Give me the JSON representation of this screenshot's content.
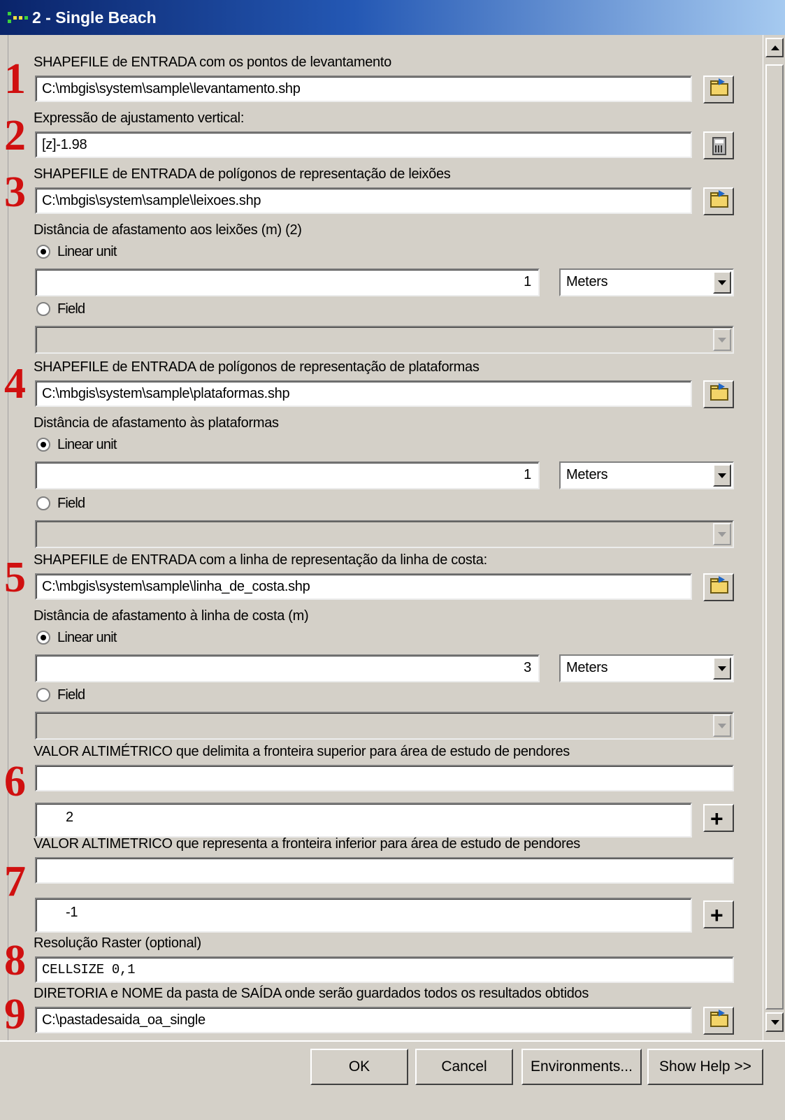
{
  "window": {
    "title": "2 - Single Beach",
    "icon": "toolbox-model-icon"
  },
  "numbers": [
    "1",
    "2",
    "3",
    "4",
    "5",
    "6",
    "7",
    "8",
    "9"
  ],
  "params": {
    "p1": {
      "label": "SHAPEFILE de ENTRADA com os pontos de levantamento",
      "value": "C:\\mbgis\\system\\sample\\levantamento.shp"
    },
    "p2": {
      "label": "Expressão de ajustamento vertical:",
      "value": "[z]-1.98"
    },
    "p3": {
      "label": "SHAPEFILE de ENTRADA de polígonos de representação de leixões",
      "value": "C:\\mbgis\\system\\sample\\leixoes.shp",
      "distance_label": "Distância de afastamento aos leixões (m) (2)",
      "linear_unit": "Linear unit",
      "linear_value": "1",
      "unit": "Meters",
      "field": "Field",
      "field_value": ""
    },
    "p4": {
      "label": "SHAPEFILE de ENTRADA de polígonos de representação de plataformas",
      "value": "C:\\mbgis\\system\\sample\\plataformas.shp",
      "distance_label": "Distância de afastamento às plataformas",
      "linear_unit": "Linear unit",
      "linear_value": "1",
      "unit": "Meters",
      "field": "Field",
      "field_value": ""
    },
    "p5": {
      "label": "SHAPEFILE de ENTRADA com a linha de representação da linha de costa:",
      "value": "C:\\mbgis\\system\\sample\\linha_de_costa.shp",
      "distance_label": "Distância de afastamento à linha de costa (m)",
      "linear_unit": "Linear unit",
      "linear_value": "3",
      "unit": "Meters",
      "field": "Field",
      "field_value": ""
    },
    "p6": {
      "label": "VALOR ALTIMÉTRICO que delimita a fronteira superior para área de estudo de pendores",
      "input": "",
      "list_value": "2"
    },
    "p7": {
      "label": "VALOR ALTIMETRICO que representa a fronteira inferior para área de estudo de pendores",
      "input": "",
      "list_value": "-1"
    },
    "p8": {
      "label": "Resolução Raster (optional)",
      "value": "CELLSIZE 0,1"
    },
    "p9": {
      "label": "DIRETORIA e NOME da pasta de SAÍDA onde serão guardados todos os resultados obtidos",
      "value": "C:\\pastadesaida_oa_single"
    }
  },
  "buttons": {
    "ok": "OK",
    "cancel": "Cancel",
    "environments": "Environments...",
    "help": "Show Help >>"
  },
  "colors": {
    "annotation_numbers": "#d01010",
    "title_bar": "#0a246a"
  }
}
